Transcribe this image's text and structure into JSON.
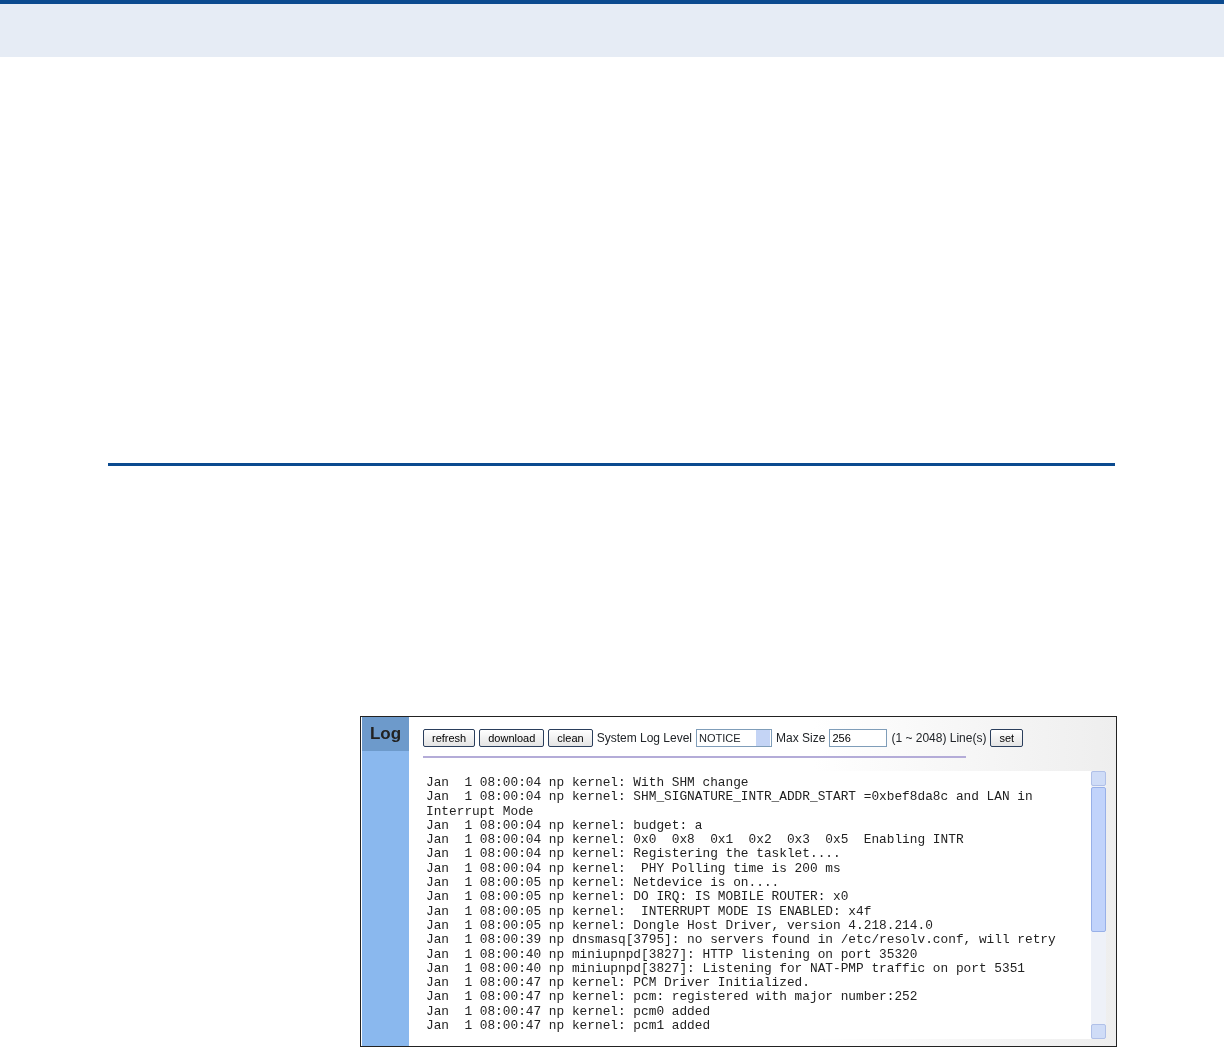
{
  "panel": {
    "title": "Log"
  },
  "toolbar": {
    "buttons": [
      "refresh",
      "download",
      "clean"
    ],
    "log_level_label": "System Log Level",
    "log_level": {
      "value": "NOTICE"
    },
    "max_size_label": "Max Size",
    "max_size": {
      "value": "256"
    },
    "range_label": "(1 ~ 2048) Line(s)",
    "set_button": "set"
  },
  "log_lines": [
    "Jan  1 08:00:04 np kernel: With SHM change",
    "Jan  1 08:00:04 np kernel: SHM_SIGNATURE_INTR_ADDR_START =0xbef8da8c and LAN in Interrupt Mode",
    "Jan  1 08:00:04 np kernel: budget: a",
    "Jan  1 08:00:04 np kernel: 0x0  0x8  0x1  0x2  0x3  0x5  Enabling INTR",
    "Jan  1 08:00:04 np kernel: Registering the tasklet....",
    "Jan  1 08:00:04 np kernel:  PHY Polling time is 200 ms",
    "Jan  1 08:00:05 np kernel: Netdevice is on....",
    "Jan  1 08:00:05 np kernel: DO IRQ: IS MOBILE ROUTER: x0",
    "Jan  1 08:00:05 np kernel:  INTERRUPT MODE IS ENABLED: x4f",
    "Jan  1 08:00:05 np kernel: Dongle Host Driver, version 4.218.214.0",
    "Jan  1 08:00:39 np dnsmasq[3795]: no servers found in /etc/resolv.conf, will retry",
    "Jan  1 08:00:40 np miniupnpd[3827]: HTTP listening on port 35320",
    "Jan  1 08:00:40 np miniupnpd[3827]: Listening for NAT-PMP traffic on port 5351",
    "Jan  1 08:00:47 np kernel: PCM Driver Initialized.",
    "Jan  1 08:00:47 np kernel: pcm: registered with major number:252",
    "Jan  1 08:00:47 np kernel: pcm0 added",
    "Jan  1 08:00:47 np kernel: pcm1 added"
  ]
}
